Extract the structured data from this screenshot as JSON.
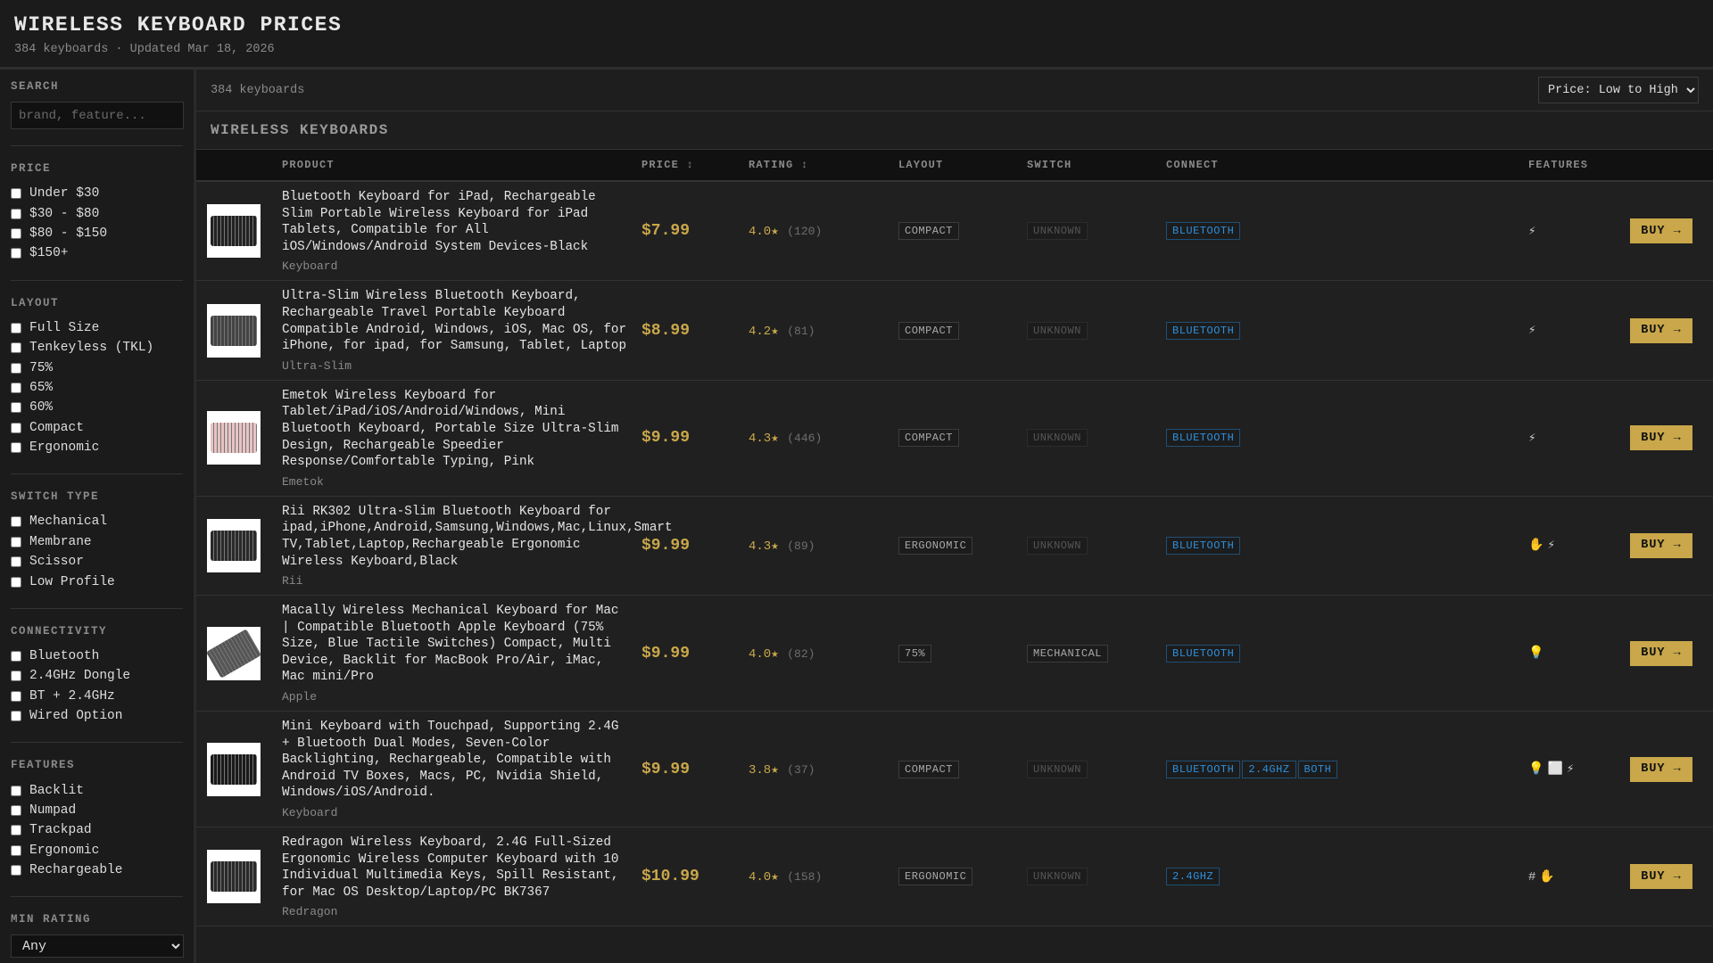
{
  "header": {
    "title": "WIRELESS KEYBOARD PRICES",
    "subtitle": "384 keyboards · Updated Mar 18, 2026"
  },
  "sidebar": {
    "search": {
      "heading": "SEARCH",
      "placeholder": "brand, feature..."
    },
    "groups": [
      {
        "heading": "PRICE",
        "options": [
          "Under $30",
          "$30 - $80",
          "$80 - $150",
          "$150+"
        ]
      },
      {
        "heading": "LAYOUT",
        "options": [
          "Full Size",
          "Tenkeyless (TKL)",
          "75%",
          "65%",
          "60%",
          "Compact",
          "Ergonomic"
        ]
      },
      {
        "heading": "SWITCH TYPE",
        "options": [
          "Mechanical",
          "Membrane",
          "Scissor",
          "Low Profile"
        ]
      },
      {
        "heading": "CONNECTIVITY",
        "options": [
          "Bluetooth",
          "2.4GHz Dongle",
          "BT + 2.4GHz",
          "Wired Option"
        ]
      },
      {
        "heading": "FEATURES",
        "options": [
          "Backlit",
          "Numpad",
          "Trackpad",
          "Ergonomic",
          "Rechargeable"
        ]
      }
    ],
    "min_rating": {
      "heading": "MIN RATING",
      "value": "Any"
    }
  },
  "toolbar": {
    "count": "384 keyboards",
    "sort": "Price: Low to High"
  },
  "section_title": "WIRELESS KEYBOARDS",
  "columns": [
    "",
    "PRODUCT",
    "PRICE ↕",
    "RATING ↕",
    "LAYOUT",
    "SWITCH",
    "CONNECT",
    "FEATURES",
    ""
  ],
  "buy_label": "BUY →",
  "colors": {
    "accent": "#c9a74a",
    "connect": "#2e8fdc"
  },
  "products": [
    {
      "name": "Bluetooth Keyboard for iPad, Rechargeable Slim Portable Wireless Keyboard for iPad Tablets, Compatible for All iOS/Windows/Android System Devices-Black",
      "brand": "Keyboard",
      "price": "$7.99",
      "rating": "4.0★",
      "reviews": "(120)",
      "layout": "COMPACT",
      "switch": "UNKNOWN",
      "connect": [
        "BLUETOOTH"
      ],
      "features": [
        "⚡"
      ],
      "thumb": "#222"
    },
    {
      "name": "Ultra-Slim Wireless Bluetooth Keyboard, Rechargeable Travel Portable Keyboard Compatible Android, Windows, iOS, Mac OS, for iPhone, for ipad, for Samsung, Tablet, Laptop",
      "brand": "Ultra-Slim",
      "price": "$8.99",
      "rating": "4.2★",
      "reviews": "(81)",
      "layout": "COMPACT",
      "switch": "UNKNOWN",
      "connect": [
        "BLUETOOTH"
      ],
      "features": [
        "⚡"
      ],
      "thumb": "#444"
    },
    {
      "name": "Emetok Wireless Keyboard for Tablet/iPad/iOS/Android/Windows, Mini Bluetooth Keyboard, Portable Size Ultra-Slim Design, Rechargeable Speedier Response/Comfortable Typing, Pink",
      "brand": "Emetok",
      "price": "$9.99",
      "rating": "4.3★",
      "reviews": "(446)",
      "layout": "COMPACT",
      "switch": "UNKNOWN",
      "connect": [
        "BLUETOOTH"
      ],
      "features": [
        "⚡"
      ],
      "thumb": "#e8c4c4"
    },
    {
      "name": "Rii RK302 Ultra-Slim Bluetooth Keyboard for ipad,iPhone,Android,Samsung,Windows,Mac,Linux,Smart TV,Tablet,Laptop,Rechargeable Ergonomic Wireless Keyboard,Black",
      "brand": "Rii",
      "price": "$9.99",
      "rating": "4.3★",
      "reviews": "(89)",
      "layout": "ERGONOMIC",
      "switch": "UNKNOWN",
      "connect": [
        "BLUETOOTH"
      ],
      "features": [
        "✋",
        "⚡"
      ],
      "thumb": "#2a2a2a"
    },
    {
      "name": "Macally Wireless Mechanical Keyboard for Mac | Compatible Bluetooth Apple Keyboard (75% Size, Blue Tactile Switches) Compact, Multi Device, Backlit for MacBook Pro/Air, iMac, Mac mini/Pro",
      "brand": "Apple",
      "price": "$9.99",
      "rating": "4.0★",
      "reviews": "(82)",
      "layout": "75%",
      "switch": "MECHANICAL",
      "connect": [
        "BLUETOOTH"
      ],
      "features": [
        "💡"
      ],
      "thumb": "#555"
    },
    {
      "name": "Mini Keyboard with Touchpad, Supporting 2.4G + Bluetooth Dual Modes, Seven-Color Backlighting, Rechargeable, Compatible with Android TV Boxes, Macs, PC, Nvidia Shield, Windows/iOS/Android.",
      "brand": "Keyboard",
      "price": "$9.99",
      "rating": "3.8★",
      "reviews": "(37)",
      "layout": "COMPACT",
      "switch": "UNKNOWN",
      "connect": [
        "BLUETOOTH",
        "2.4GHZ",
        "BOTH"
      ],
      "features": [
        "💡",
        "⬜",
        "⚡"
      ],
      "thumb": "#1a1a1a"
    },
    {
      "name": "Redragon Wireless Keyboard, 2.4G Full-Sized Ergonomic Wireless Computer Keyboard with 10 Individual Multimedia Keys, Spill Resistant, for Mac OS Desktop/Laptop/PC BK7367",
      "brand": "Redragon",
      "price": "$10.99",
      "rating": "4.0★",
      "reviews": "(158)",
      "layout": "ERGONOMIC",
      "switch": "UNKNOWN",
      "connect": [
        "2.4GHZ"
      ],
      "features": [
        "#",
        "✋"
      ],
      "thumb": "#2a2a2a"
    }
  ]
}
